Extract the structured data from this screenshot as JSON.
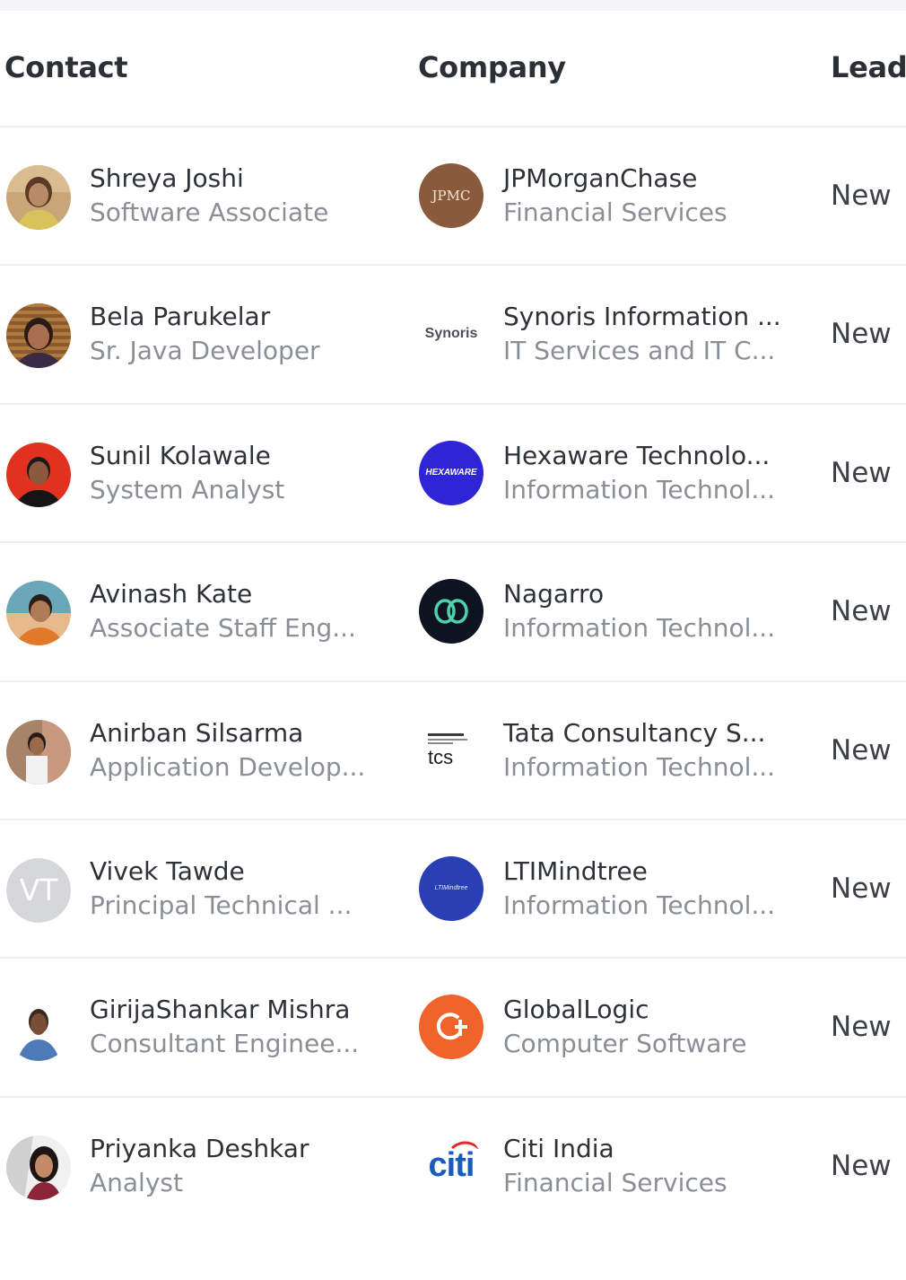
{
  "table": {
    "headers": {
      "contact": "Contact",
      "company": "Company",
      "lead": "Lead"
    },
    "rows": [
      {
        "name": "Shreya Joshi",
        "title": "Software Associate",
        "company": "JPMorganChase",
        "industry": "Financial Services",
        "lead": "New",
        "logo": "jpmc-logo",
        "logo_text": "JPMC"
      },
      {
        "name": "Bela Parukelar",
        "title": "Sr. Java Developer",
        "company": "Synoris Information ...",
        "industry": "IT Services and IT C...",
        "lead": "New",
        "logo": "synoris-logo",
        "logo_text": "Synoris"
      },
      {
        "name": "Sunil Kolawale",
        "title": "System Analyst",
        "company": "Hexaware Technolo...",
        "industry": "Information Technol...",
        "lead": "New",
        "logo": "hexaware-logo",
        "logo_text": "HEXAWARE"
      },
      {
        "name": "Avinash Kate",
        "title": "Associate Staff Eng...",
        "company": "Nagarro",
        "industry": "Information Technol...",
        "lead": "New",
        "logo": "nagarro-logo",
        "logo_text": ""
      },
      {
        "name": "Anirban Silsarma",
        "title": "Application Develop...",
        "company": "Tata Consultancy S...",
        "industry": "Information Technol...",
        "lead": "New",
        "logo": "tcs-logo",
        "logo_text": "tcs"
      },
      {
        "name": "Vivek Tawde",
        "title": "Principal Technical ...",
        "company": "LTIMindtree",
        "industry": "Information Technol...",
        "lead": "New",
        "logo": "ltimindtree-logo",
        "logo_text": "LTIMindtree",
        "initials": "VT"
      },
      {
        "name": "GirijaShankar Mishra",
        "title": "Consultant Enginee...",
        "company": "GlobalLogic",
        "industry": "Computer Software",
        "lead": "New",
        "logo": "globallogic-logo",
        "logo_text": ""
      },
      {
        "name": "Priyanka Deshkar",
        "title": "Analyst",
        "company": "Citi India",
        "industry": "Financial Services",
        "lead": "New",
        "logo": "citi-logo",
        "logo_text": "citi"
      }
    ]
  },
  "colors": {
    "header_text": "#2b3037",
    "primary_text": "#2d3138",
    "secondary_text": "#8a8f97",
    "divider": "#eceef1"
  }
}
